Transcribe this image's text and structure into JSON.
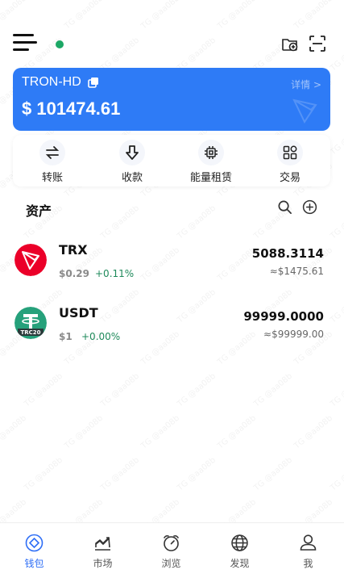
{
  "wallet": {
    "name": "TRON-HD",
    "detail_label": "详情 >",
    "balance": "$ 101474.61"
  },
  "actions": [
    {
      "label": "转账",
      "icon": "transfer-icon"
    },
    {
      "label": "收款",
      "icon": "receive-icon"
    },
    {
      "label": "能量租赁",
      "icon": "chip-icon"
    },
    {
      "label": "交易",
      "icon": "grid-icon"
    }
  ],
  "assets": {
    "title": "资产",
    "items": [
      {
        "symbol": "TRX",
        "price": "$0.29",
        "change": "+0.11%",
        "amount": "5088.3114",
        "value": "≈$1475.61",
        "logo": "trx-logo"
      },
      {
        "symbol": "USDT",
        "price": "$1",
        "change": "+0.00%",
        "amount": "99999.0000",
        "value": "≈$99999.00",
        "logo": "usdt-trc20-logo"
      }
    ]
  },
  "nav": [
    {
      "label": "钱包",
      "icon": "wallet-icon",
      "active": true
    },
    {
      "label": "市场",
      "icon": "market-icon",
      "active": false
    },
    {
      "label": "浏览",
      "icon": "browse-icon",
      "active": false
    },
    {
      "label": "发现",
      "icon": "globe-icon",
      "active": false
    },
    {
      "label": "我",
      "icon": "profile-icon",
      "active": false
    }
  ],
  "watermark_text": "TG @aa08b",
  "colors": {
    "brand_blue": "#2e7bf6",
    "positive_green": "#1f8a5b",
    "status_green": "#1ca765",
    "trx_red": "#eb0029",
    "usdt_teal": "#26a17b"
  }
}
